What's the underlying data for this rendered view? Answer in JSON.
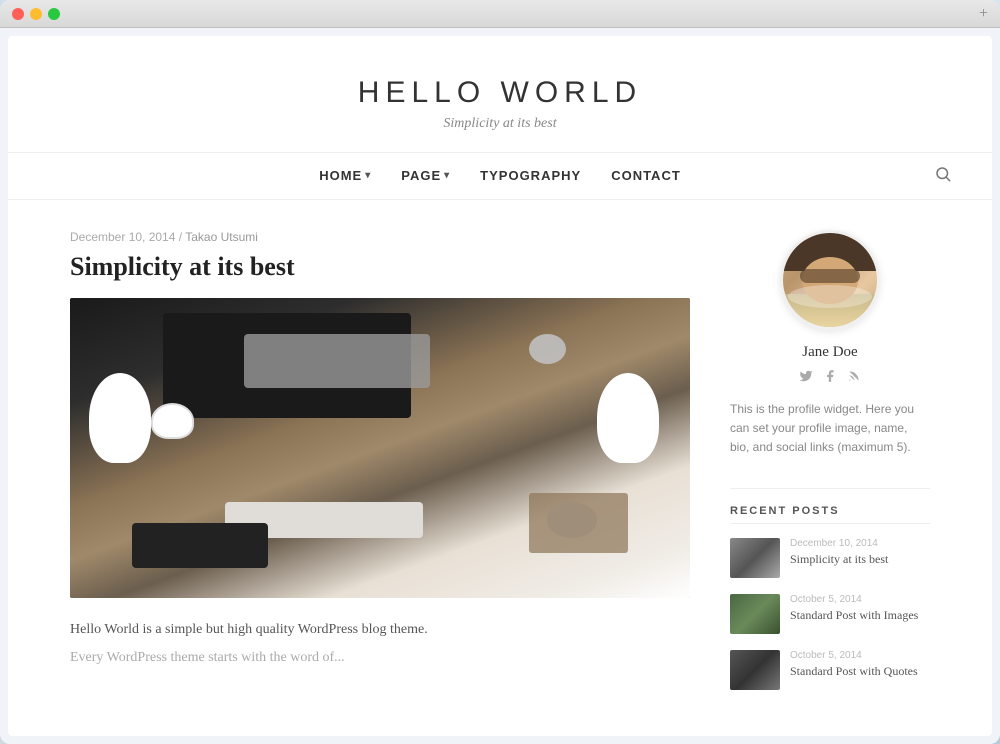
{
  "window": {
    "plus_label": "+"
  },
  "site": {
    "title": "HELLO WORLD",
    "tagline": "Simplicity at its best"
  },
  "nav": {
    "items": [
      {
        "label": "HOME",
        "has_dropdown": true
      },
      {
        "label": "PAGE",
        "has_dropdown": true
      },
      {
        "label": "TYPOGRAPHY",
        "has_dropdown": false
      },
      {
        "label": "CONTACT",
        "has_dropdown": false
      }
    ],
    "search_icon": "🔍"
  },
  "post": {
    "date": "December 10, 2014",
    "separator": "/",
    "author": "Takao Utsumi",
    "title": "Simplicity at its best",
    "excerpt": "Hello World is a simple but high quality WordPress blog theme.",
    "excerpt_2": "Every WordPress theme starts with the word of..."
  },
  "sidebar": {
    "profile": {
      "name": "Jane Doe",
      "bio": "This is the profile widget. Here you can set your profile image, name, bio, and social links (maximum 5).",
      "social": {
        "twitter": "🐦",
        "facebook": "f",
        "rss": "▤"
      }
    },
    "recent_posts": {
      "section_title": "RECENT POSTS",
      "items": [
        {
          "date": "December 10, 2014",
          "title": "Simplicity at its best",
          "thumb_class": "thumb-1"
        },
        {
          "date": "October 5, 2014",
          "title": "Standard Post with Images",
          "thumb_class": "thumb-2"
        },
        {
          "date": "October 5, 2014",
          "title": "Standard Post with Quotes",
          "thumb_class": "thumb-3"
        }
      ]
    }
  }
}
